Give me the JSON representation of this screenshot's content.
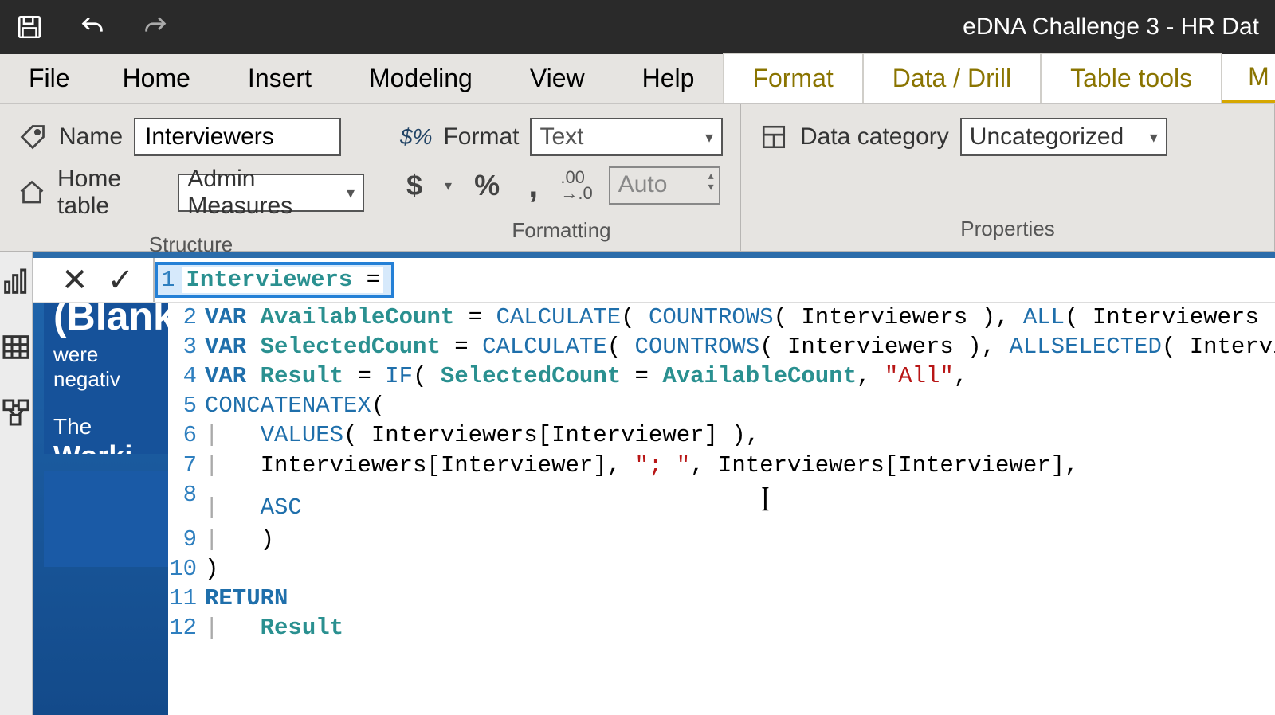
{
  "titlebar": {
    "title": "eDNA Challenge 3 - HR Dat"
  },
  "menu": {
    "file": "File",
    "tabs": [
      "Home",
      "Insert",
      "Modeling",
      "View",
      "Help"
    ],
    "contextual": [
      "Format",
      "Data / Drill",
      "Table tools"
    ],
    "last_partial": "M"
  },
  "ribbon": {
    "structure": {
      "caption": "Structure",
      "name_label": "Name",
      "name_value": "Interviewers",
      "home_table_label": "Home table",
      "home_table_value": "Admin Measures"
    },
    "formatting": {
      "caption": "Formatting",
      "format_label": "Format",
      "format_value": "Text",
      "decimal_value": "Auto",
      "currency": "$",
      "percent": "%",
      "comma": ",",
      "decimals": ".00→.0"
    },
    "properties": {
      "caption": "Properties",
      "category_label": "Data category",
      "category_value": "Uncategorized"
    }
  },
  "formula_commit": {
    "cancel": "✕",
    "confirm": "✓"
  },
  "code_lines": [
    {
      "n": "1",
      "raw": "Interviewers ="
    },
    {
      "n": "2"
    },
    {
      "n": "3"
    },
    {
      "n": "4"
    },
    {
      "n": "5"
    },
    {
      "n": "6"
    },
    {
      "n": "7"
    },
    {
      "n": "8"
    },
    {
      "n": "9"
    },
    {
      "n": "10"
    },
    {
      "n": "11"
    },
    {
      "n": "12"
    }
  ],
  "dax": {
    "line1_ident": "Interviewers",
    "line1_eq": " =",
    "var": "VAR",
    "avail": "AvailableCount",
    "sel": "SelectedCount",
    "res": "Result",
    "calc": "CALCULATE",
    "countrows": "COUNTROWS",
    "all": "ALL",
    "allselected": "ALLSELECTED",
    "if": "IF",
    "concatx": "CONCATENATEX",
    "values": "VALUES",
    "tbl": "Interviewers",
    "col": "Interviewers[Interviewer]",
    "str_all": "\"All\"",
    "str_sep": "\"; \"",
    "asc": "ASC",
    "return": "RETURN",
    "result_ref": "Result",
    "eq": " = ",
    "lp": "( ",
    "rp": " )",
    "rpc": " ),",
    "c": ", ",
    "comma": ","
  },
  "blue_card": {
    "blank": "(Blank)",
    "sub": "were negativ",
    "line2a": "The ",
    "line2b": "Worki"
  }
}
